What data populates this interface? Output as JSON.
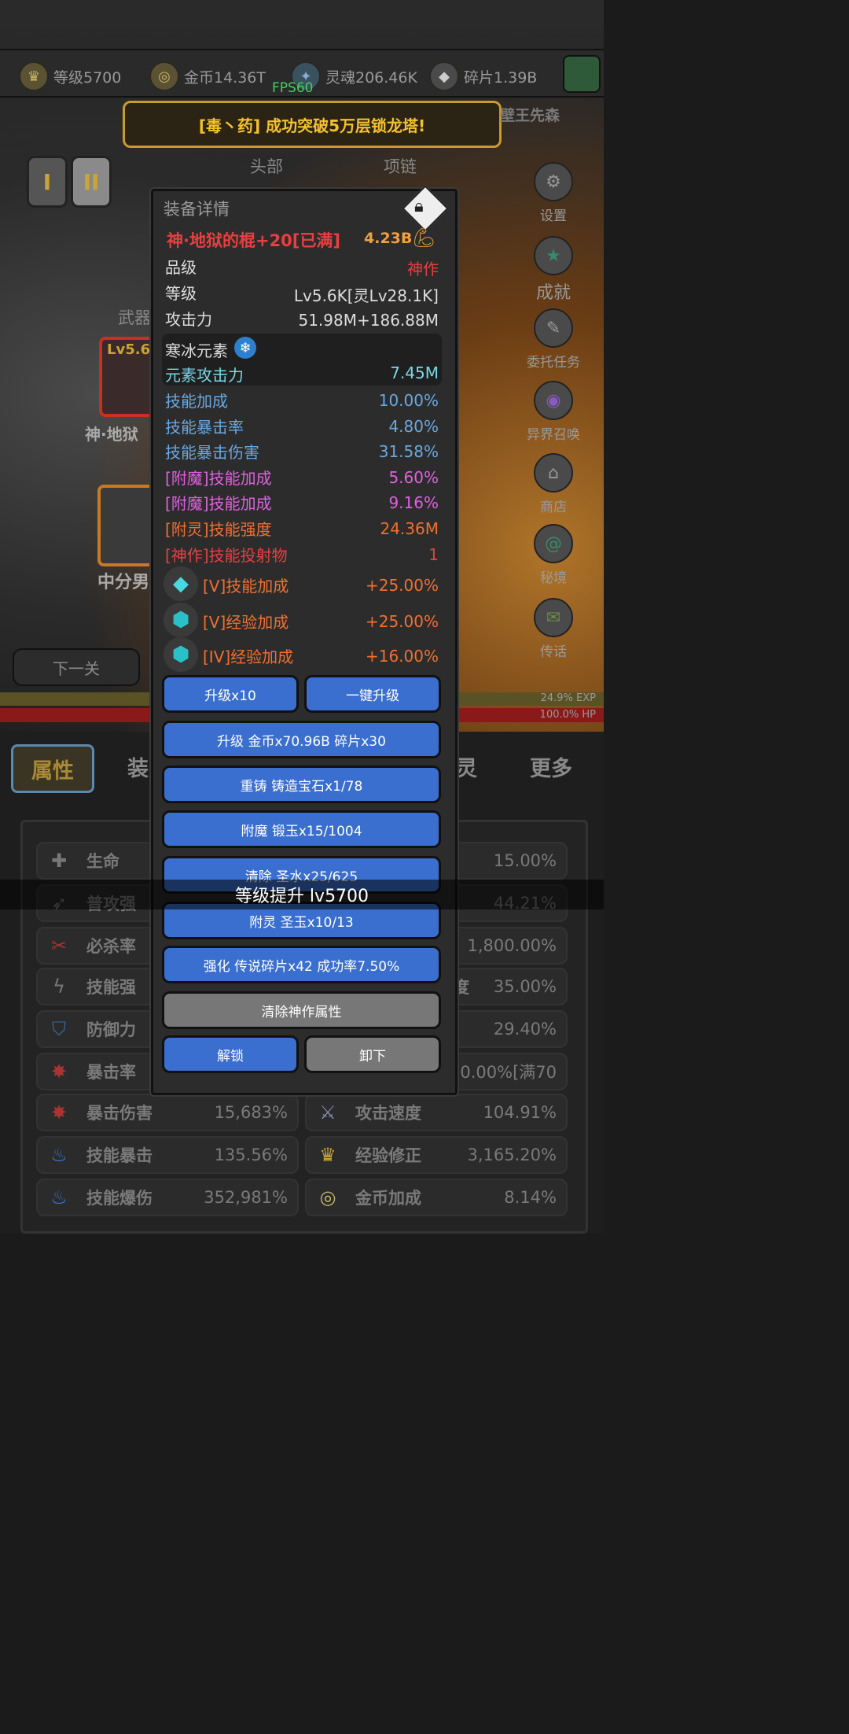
{
  "resources": [
    {
      "icon": "crown-icon",
      "label": "等级5700"
    },
    {
      "icon": "coin-icon",
      "label": "金币14.36T"
    },
    {
      "icon": "soul-icon",
      "label": "灵魂206.46K"
    },
    {
      "icon": "shard-icon",
      "label": "碎片1.39B"
    }
  ],
  "fps": "FPS60",
  "banner": "[毒丶药] 成功突破5万层锁龙塔!",
  "banner_right": "壁王先森",
  "tabs_roman": [
    "I",
    "II"
  ],
  "slot_labels": {
    "head": "头部",
    "necklace": "项链",
    "weapon": "武器"
  },
  "weapon_slot": {
    "level": "Lv5.6",
    "name": "神·地狱"
  },
  "second_slot": {
    "name": "中分男"
  },
  "side_menu": [
    {
      "icon": "gear-icon",
      "label": "设置"
    },
    {
      "icon": "star-icon",
      "label": "成就"
    },
    {
      "icon": "scroll-icon",
      "label": "委托任务"
    },
    {
      "icon": "eye-icon",
      "label": "异界召唤"
    },
    {
      "icon": "shop-icon",
      "label": "商店"
    },
    {
      "icon": "portal-icon",
      "label": "秘境"
    },
    {
      "icon": "horn-icon",
      "label": "传话"
    }
  ],
  "next_level": "下一关",
  "exp_text": "24.9% EXP",
  "hp_text": "100.0%  HP",
  "bottom_tabs": [
    "属性",
    "装",
    "灵",
    "更多"
  ],
  "attributes_left": [
    {
      "icon": "cross-icon",
      "name": "生命",
      "value": ""
    },
    {
      "icon": "claw-icon",
      "name": "普攻强",
      "value": ""
    },
    {
      "icon": "slash-icon",
      "name": "必杀率",
      "value": ""
    },
    {
      "icon": "lightning-icon",
      "name": "技能强",
      "value": ""
    },
    {
      "icon": "shield-icon",
      "name": "防御力",
      "value": ""
    },
    {
      "icon": "crit-icon",
      "name": "暴击率",
      "value": ""
    },
    {
      "icon": "crit-damage-icon",
      "name": "暴击伤害",
      "value": "15,683%"
    },
    {
      "icon": "flame-icon",
      "name": "技能暴击",
      "value": "135.56%"
    },
    {
      "icon": "flame-burst-icon",
      "name": "技能爆伤",
      "value": "352,981%"
    }
  ],
  "attributes_right": [
    {
      "icon": "",
      "name": "",
      "value": "15.00%"
    },
    {
      "icon": "",
      "name": "",
      "value": "44.21%"
    },
    {
      "icon": "",
      "name": "",
      "value": "1,800.00%"
    },
    {
      "icon": "",
      "name": "度",
      "value": "35.00%"
    },
    {
      "icon": "",
      "name": "",
      "value": "29.40%"
    },
    {
      "icon": "",
      "name": "",
      "value": "0.00%[满70"
    },
    {
      "icon": "swords-icon",
      "name": "攻击速度",
      "value": "104.91%"
    },
    {
      "icon": "crown-icon",
      "name": "经验修正",
      "value": "3,165.20%"
    },
    {
      "icon": "coin-icon",
      "name": "金币加成",
      "value": "8.14%"
    }
  ],
  "modal": {
    "title": "装备详情",
    "item_name": "神·地狱的棍+20[已满]",
    "power": "4.23B",
    "grade_label": "品级",
    "grade_value": "神作",
    "level_label": "等级",
    "level_value": "Lv5.6K[灵Lv28.1K]",
    "attack_label": "攻击力",
    "attack_value": "51.98M+186.88M",
    "element_name": "寒冰元素",
    "element_attack_label": "元素攻击力",
    "element_attack_value": "7.45M",
    "stats": [
      {
        "label": "技能加成",
        "value": "10.00%",
        "color": "#6aa8e0"
      },
      {
        "label": "技能暴击率",
        "value": "4.80%",
        "color": "#6aa8e0"
      },
      {
        "label": "技能暴击伤害",
        "value": "31.58%",
        "color": "#6aa8e0"
      },
      {
        "label": "[附魔]技能加成",
        "value": "5.60%",
        "color": "#e060e0"
      },
      {
        "label": "[附魔]技能加成",
        "value": "9.16%",
        "color": "#e060e0"
      },
      {
        "label": "[附灵]技能强度",
        "value": "24.36M",
        "color": "#f07030"
      },
      {
        "label": "[神作]技能投射物",
        "value": "1",
        "color": "#e64040"
      }
    ],
    "gems": [
      {
        "icon": "diamond-icon",
        "label": "[V]技能加成",
        "value": "+25.00%"
      },
      {
        "icon": "gem-icon",
        "label": "[V]经验加成",
        "value": "+25.00%"
      },
      {
        "icon": "gem-icon",
        "label": "[IV]经验加成",
        "value": "+16.00%"
      }
    ],
    "buttons": {
      "upgrade10": "升级x10",
      "oneclick": "一键升级",
      "upgrade": "升级 金币x70.96B 碎片x30",
      "recast": "重铸 铸造宝石x1/78",
      "enchant": "附魔 锻玉x15/1004",
      "clear": "清除 圣水x25/625",
      "spirit": "附灵 圣玉x10/13",
      "strengthen": "强化 传说碎片x42 成功率7.50%",
      "clear_divine": "清除神作属性",
      "unlock": "解锁",
      "unequip": "卸下"
    }
  },
  "toast": "等级提升 lv5700"
}
